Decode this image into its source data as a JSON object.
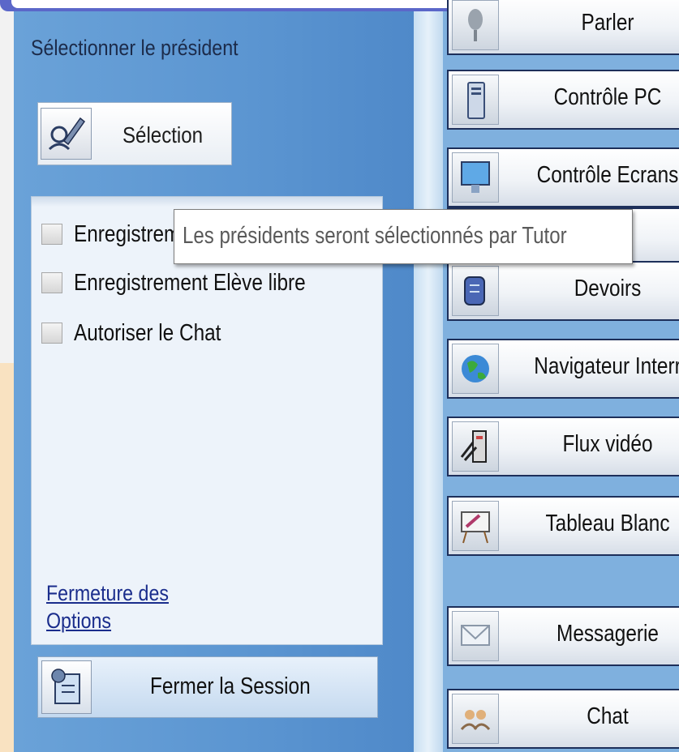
{
  "left_panel": {
    "title": "Sélectionner le président",
    "selection_button": {
      "label": "Sélection",
      "icon": "pen-user-icon"
    },
    "options": [
      {
        "label": "Enregistrement",
        "checked": false
      },
      {
        "label": "Enregistrement Elève libre",
        "checked": false
      },
      {
        "label": "Autoriser le Chat",
        "checked": false
      }
    ],
    "close_options_link": "Fermeture des Options",
    "close_session_button": {
      "label": "Fermer la Session",
      "icon": "close-session-icon"
    }
  },
  "tooltip": {
    "text": "Les présidents seront sélectionnés par Tutor"
  },
  "commands": [
    {
      "label": "Parler",
      "icon": "microphone-icon"
    },
    {
      "label": "Contrôle PC",
      "icon": "pc-tower-icon"
    },
    {
      "label": "Contrôle Ecrans",
      "icon": "monitor-icon"
    },
    {
      "label": "",
      "icon": "blank-icon"
    },
    {
      "label": "Devoirs",
      "icon": "homework-icon"
    },
    {
      "label": "Navigateur Interr",
      "icon": "globe-icon"
    },
    {
      "label": "Flux vidéo",
      "icon": "video-stream-icon"
    },
    {
      "label": "Tableau Blanc",
      "icon": "whiteboard-icon"
    },
    {
      "label": "Messagerie",
      "icon": "envelope-icon"
    },
    {
      "label": "Chat",
      "icon": "chat-people-icon"
    }
  ],
  "colors": {
    "panel_blue": "#5b95d1",
    "link_blue": "#1a2d8c",
    "button_border": "#1d2f5a"
  }
}
